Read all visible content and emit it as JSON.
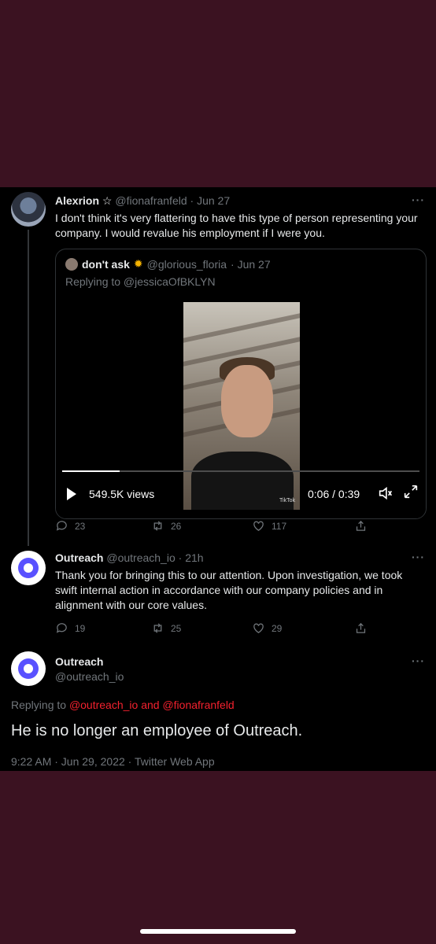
{
  "colors": {
    "background": "#3b1221",
    "panel": "#000000",
    "text": "#e7e9ea",
    "muted": "#71767b",
    "mention": "#f4212e",
    "outreach_brand": "#5951ff"
  },
  "tweet1": {
    "name": "Alexrion",
    "star": "☆",
    "handle": "@fionafranfeld",
    "date": "· Jun 27",
    "text": "I don't think it's very flattering to have this type of person representing your company. I would revalue his employment if I were you.",
    "more": "···",
    "quote": {
      "name": "don't ask",
      "emoji": "✹",
      "handle": "@glorious_floria",
      "date": "· Jun 27",
      "replying": "Replying to @jessicaOfBKLYN",
      "video": {
        "views": "549.5K views",
        "time": "0:06 / 0:39",
        "progress": 0.16,
        "watermark": "TikTok",
        "volume_icon": "volume-icon",
        "expand_icon": "expand-icon"
      }
    },
    "actions": {
      "replies": "23",
      "retweets": "26",
      "likes": "117"
    }
  },
  "tweet2": {
    "name": "Outreach",
    "handle": "@outreach_io",
    "date": "· 21h",
    "text": "Thank you for bringing this to our attention. Upon investigation, we took swift internal action in accordance with our company policies and in alignment with our core values.",
    "more": "···",
    "actions": {
      "replies": "19",
      "retweets": "25",
      "likes": "29"
    }
  },
  "tweet3": {
    "name": "Outreach",
    "handle": "@outreach_io",
    "more": "···",
    "replying_prefix": "Replying to ",
    "replying_mentions": "@outreach_io and @fionafranfeld",
    "text": "He is no longer an employee of Outreach.",
    "timestamp": "9:22 AM · Jun 29, 2022 · Twitter Web App"
  }
}
